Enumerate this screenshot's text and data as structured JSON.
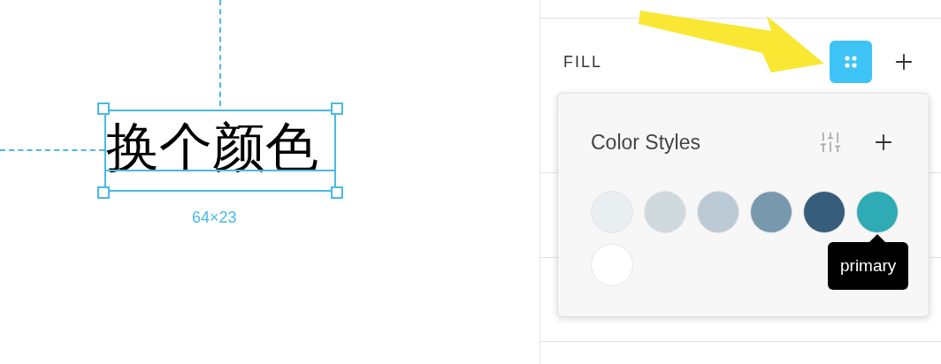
{
  "canvas": {
    "text_layer": {
      "text": "换个颜色",
      "selected": true,
      "size_label": "64×23"
    }
  },
  "panel": {
    "fill": {
      "label": "FILL",
      "styles_button": {
        "active": true
      }
    },
    "color_styles": {
      "title": "Color Styles",
      "swatches": [
        {
          "color": "#e9eef0"
        },
        {
          "color": "#cfd9de"
        },
        {
          "color": "#bccad5"
        },
        {
          "color": "#7898ae"
        },
        {
          "color": "#365d7b"
        },
        {
          "color": "#2eabb5",
          "tooltip": "primary"
        },
        {
          "color": "#ffffff"
        }
      ]
    }
  }
}
